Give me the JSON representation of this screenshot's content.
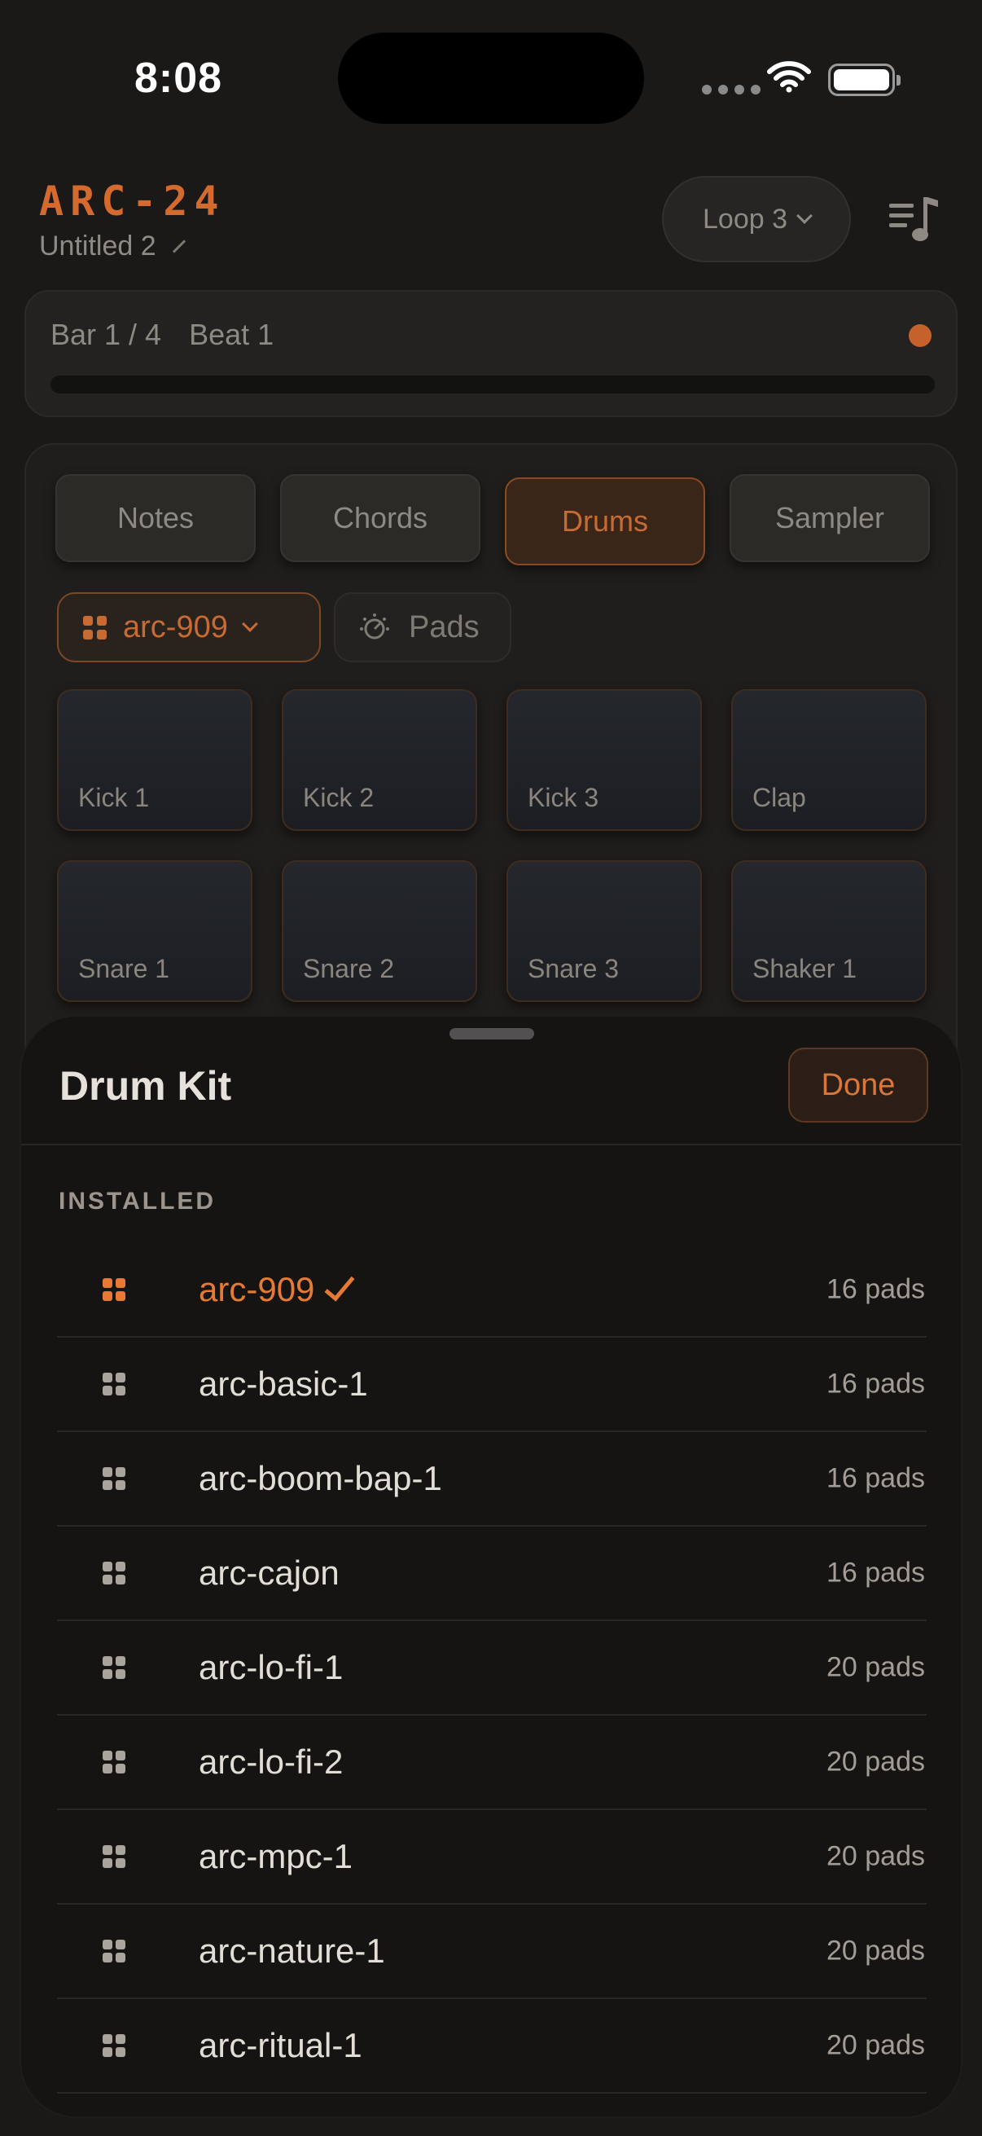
{
  "status_bar": {
    "time": "8:08"
  },
  "header": {
    "title": "ARC-24",
    "subtitle": "Untitled 2",
    "loop_label": "Loop 3"
  },
  "transport": {
    "bar": "Bar 1 / 4",
    "beat": "Beat 1"
  },
  "tabs": [
    {
      "label": "Notes",
      "active": false
    },
    {
      "label": "Chords",
      "active": false
    },
    {
      "label": "Drums",
      "active": true
    },
    {
      "label": "Sampler",
      "active": false
    }
  ],
  "kit_selector": {
    "label": "arc-909",
    "pads_label": "Pads"
  },
  "pads": [
    "Kick 1",
    "Kick 2",
    "Kick 3",
    "Clap",
    "Snare 1",
    "Snare 2",
    "Snare 3",
    "Shaker 1"
  ],
  "sheet": {
    "title": "Drum Kit",
    "done_label": "Done",
    "section_header": "INSTALLED",
    "kits": [
      {
        "name": "arc-909",
        "pads": "16 pads",
        "selected": true
      },
      {
        "name": "arc-basic-1",
        "pads": "16 pads",
        "selected": false
      },
      {
        "name": "arc-boom-bap-1",
        "pads": "16 pads",
        "selected": false
      },
      {
        "name": "arc-cajon",
        "pads": "16 pads",
        "selected": false
      },
      {
        "name": "arc-lo-fi-1",
        "pads": "20 pads",
        "selected": false
      },
      {
        "name": "arc-lo-fi-2",
        "pads": "20 pads",
        "selected": false
      },
      {
        "name": "arc-mpc-1",
        "pads": "20 pads",
        "selected": false
      },
      {
        "name": "arc-nature-1",
        "pads": "20 pads",
        "selected": false
      },
      {
        "name": "arc-ritual-1",
        "pads": "20 pads",
        "selected": false
      }
    ]
  },
  "colors": {
    "accent": "#e57a35",
    "sheet_bg": "#151413",
    "app_bg": "#1a1918"
  }
}
